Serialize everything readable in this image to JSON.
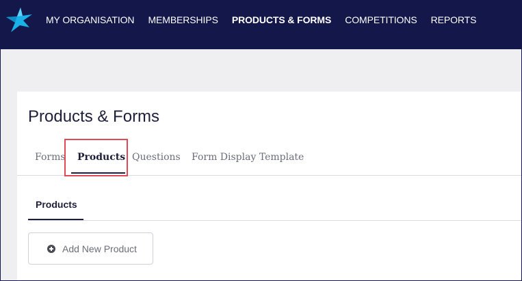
{
  "nav": {
    "items": [
      {
        "label": "MY ORGANISATION"
      },
      {
        "label": "MEMBERSHIPS"
      },
      {
        "label": "PRODUCTS & FORMS"
      },
      {
        "label": "COMPETITIONS"
      },
      {
        "label": "REPORTS"
      }
    ],
    "active_index": 2,
    "logo_icon": "star-logo-icon",
    "brand_color": "#13174a",
    "accent_color": "#1ab0e8"
  },
  "page": {
    "title": "Products & Forms"
  },
  "tabs": {
    "items": [
      {
        "label": "Forms"
      },
      {
        "label": "Products"
      },
      {
        "label": "Questions"
      },
      {
        "label": "Form Display Template"
      }
    ],
    "active_index": 1,
    "highlight_color": "#e04a55"
  },
  "subtabs": {
    "items": [
      {
        "label": "Products"
      }
    ]
  },
  "actions": {
    "add_product_label": "Add New Product",
    "add_product_icon": "plus-circle-icon"
  }
}
